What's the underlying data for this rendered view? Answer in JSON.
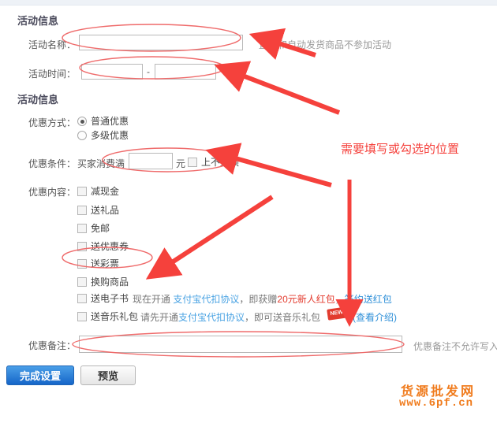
{
  "sections": {
    "activity_info_title": "活动信息",
    "promo_info_title": "活动信息"
  },
  "fields": {
    "activity_name_label": "活动名称：",
    "activity_name_value": "",
    "activity_name_hint": "直冲和自动发货商品不参加活动",
    "activity_time_label": "活动时间：",
    "activity_time_start": "",
    "activity_time_end": "",
    "activity_time_separator": "-"
  },
  "promo_method": {
    "label": "优惠方式：",
    "options": [
      {
        "label": "普通优惠",
        "checked": true
      },
      {
        "label": "多级优惠",
        "checked": false
      }
    ]
  },
  "promo_condition": {
    "label": "优惠条件：",
    "prefix": "买家消费满",
    "amount_value": "",
    "unit": "元",
    "no_cap_label": "上不封顶",
    "no_cap_checked": false
  },
  "promo_content": {
    "label": "优惠内容：",
    "items": [
      {
        "label": "减现金",
        "checked": false
      },
      {
        "label": "送礼品",
        "checked": false
      },
      {
        "label": "免邮",
        "checked": false
      },
      {
        "label": "送优惠券",
        "checked": false
      },
      {
        "label": "送彩票",
        "checked": false
      },
      {
        "label": "换购商品",
        "checked": false
      },
      {
        "label": "送电子书",
        "checked": false
      },
      {
        "label": "送音乐礼包",
        "checked": false
      }
    ],
    "ebook_note": {
      "pre": "现在开通",
      "link1": "支付宝代扣协议",
      "mid": "，即获赠",
      "highlight": "20元新人红包",
      "tail": "，",
      "link2": "签约送红包"
    },
    "music_note": {
      "pre": "请先开通",
      "link1": "支付宝代扣协议",
      "mid": "，即可送音乐礼包",
      "badge": "NEW!",
      "link2": "(查看介绍)"
    }
  },
  "promo_remark": {
    "label": "优惠备注：",
    "value": "",
    "hint": "优惠备注不允许写入"
  },
  "buttons": {
    "submit": "完成设置",
    "preview": "预览"
  },
  "annotation": {
    "text": "需要填写或勾选的位置",
    "color": "#f5413c"
  },
  "watermark": {
    "name": "货源批发网",
    "url": "www.6pf.cn",
    "color": "#f07c1e"
  }
}
